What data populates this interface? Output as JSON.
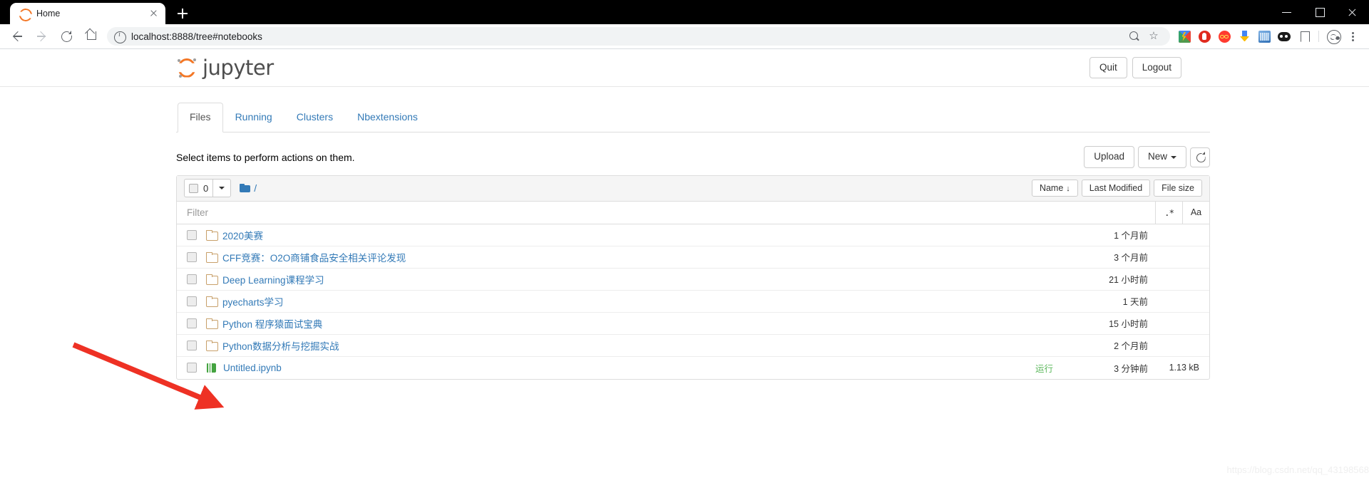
{
  "browser": {
    "tab_title": "Home",
    "tab_favicon": "jupyter-favicon",
    "url": "localhost:8888/tree#notebooks",
    "new_tab_label": "+",
    "window_controls": {
      "minimize": "minimize-icon",
      "maximize": "maximize-icon",
      "close": "close-icon"
    }
  },
  "jupyter": {
    "logo_text": "jupyter",
    "quit_label": "Quit",
    "logout_label": "Logout",
    "tabs": [
      {
        "label": "Files",
        "active": true
      },
      {
        "label": "Running",
        "active": false
      },
      {
        "label": "Clusters",
        "active": false
      },
      {
        "label": "Nbextensions",
        "active": false
      }
    ],
    "actions_hint": "Select items to perform actions on them.",
    "upload_label": "Upload",
    "new_label": "New",
    "refresh_label": "refresh-icon",
    "selected_count": "0",
    "breadcrumb_root": "/",
    "sort": {
      "name_label": "Name",
      "name_arrow": "↓",
      "last_modified_label": "Last Modified",
      "file_size_label": "File size"
    },
    "filter": {
      "placeholder": "Filter",
      "value": "",
      "regex_label": ".*",
      "case_label": "Aa"
    },
    "files": [
      {
        "name": "2020美赛",
        "type": "folder",
        "modified": "1 个月前",
        "size": "",
        "running": ""
      },
      {
        "name": "CFF竞赛：O2O商铺食品安全相关评论发现",
        "type": "folder",
        "modified": "3 个月前",
        "size": "",
        "running": ""
      },
      {
        "name": "Deep Learning课程学习",
        "type": "folder",
        "modified": "21 小时前",
        "size": "",
        "running": ""
      },
      {
        "name": "pyecharts学习",
        "type": "folder",
        "modified": "1 天前",
        "size": "",
        "running": ""
      },
      {
        "name": "Python 程序猿面试宝典",
        "type": "folder",
        "modified": "15 小时前",
        "size": "",
        "running": ""
      },
      {
        "name": "Python数据分析与挖掘实战",
        "type": "folder",
        "modified": "2 个月前",
        "size": "",
        "running": ""
      },
      {
        "name": "Untitled.ipynb",
        "type": "notebook",
        "modified": "3 分钟前",
        "size": "1.13 kB",
        "running": "运行"
      }
    ]
  },
  "watermark": "https://blog.csdn.net/qq_43198568",
  "colors": {
    "jupyter_orange": "#f37726",
    "link_blue": "#337ab7",
    "running_green": "#5cb85c",
    "notebook_green": "#44a340",
    "annotation_red": "#ee3124"
  }
}
